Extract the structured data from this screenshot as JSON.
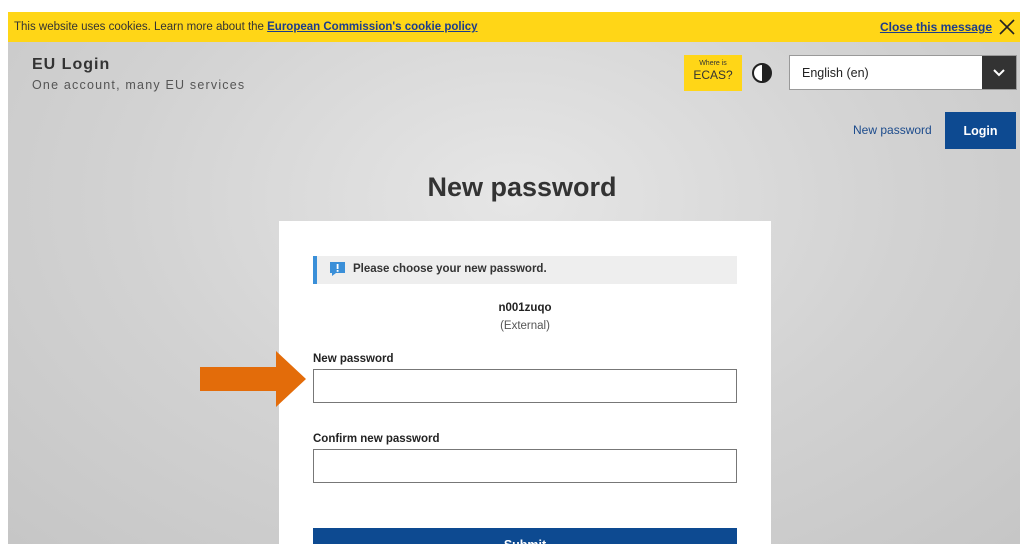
{
  "cookie_bar": {
    "text": "This website uses cookies. Learn more about the ",
    "link_text": "European Commission's cookie policy",
    "close_text": "Close this message",
    "close_icon": "close-icon"
  },
  "header": {
    "title": "EU Login",
    "subtitle": "One account, many EU services",
    "ecas_small": "Where is",
    "ecas_big": "ECAS?",
    "contrast_icon": "contrast-icon",
    "language": {
      "selected": "English (en)",
      "arrow_icon": "chevron-down-icon"
    }
  },
  "nav": {
    "new_password": "New password",
    "login": "Login"
  },
  "page": {
    "title": "New password"
  },
  "form": {
    "info_icon": "exclamation-icon",
    "info_text": "Please choose your new password.",
    "username": "n001zuqo",
    "user_type": "(External)",
    "new_password_label": "New password",
    "new_password_value": "",
    "confirm_password_label": "Confirm new password",
    "confirm_password_value": "",
    "submit_label": "Submit"
  },
  "colors": {
    "cookie_bar": "#ffd617",
    "primary_blue": "#0d4a91",
    "arrow_orange": "#e36c0a",
    "info_accent": "#3a8fd8"
  }
}
